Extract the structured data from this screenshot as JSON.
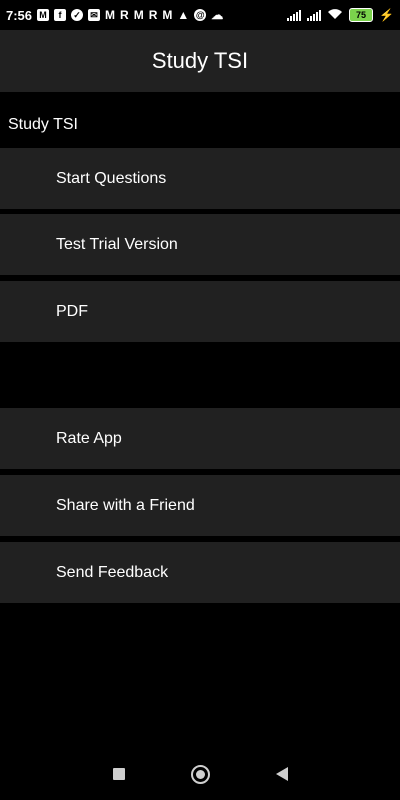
{
  "status_bar": {
    "time": "7:56",
    "notification_icons": [
      "m-icon",
      "facebook-icon",
      "check-icon",
      "mail-icon",
      "m-icon",
      "r-icon",
      "m-icon",
      "r-icon",
      "m-icon",
      "warning-icon",
      "at-icon",
      "cloud-icon"
    ],
    "battery": "75"
  },
  "app_bar": {
    "title": "Study TSI"
  },
  "section": {
    "title": "Study TSI"
  },
  "menu": {
    "start_questions": "Start Questions",
    "test_trial": "Test Trial Version",
    "pdf": "PDF",
    "rate_app": "Rate App",
    "share": "Share with a Friend",
    "feedback": "Send Feedback"
  }
}
